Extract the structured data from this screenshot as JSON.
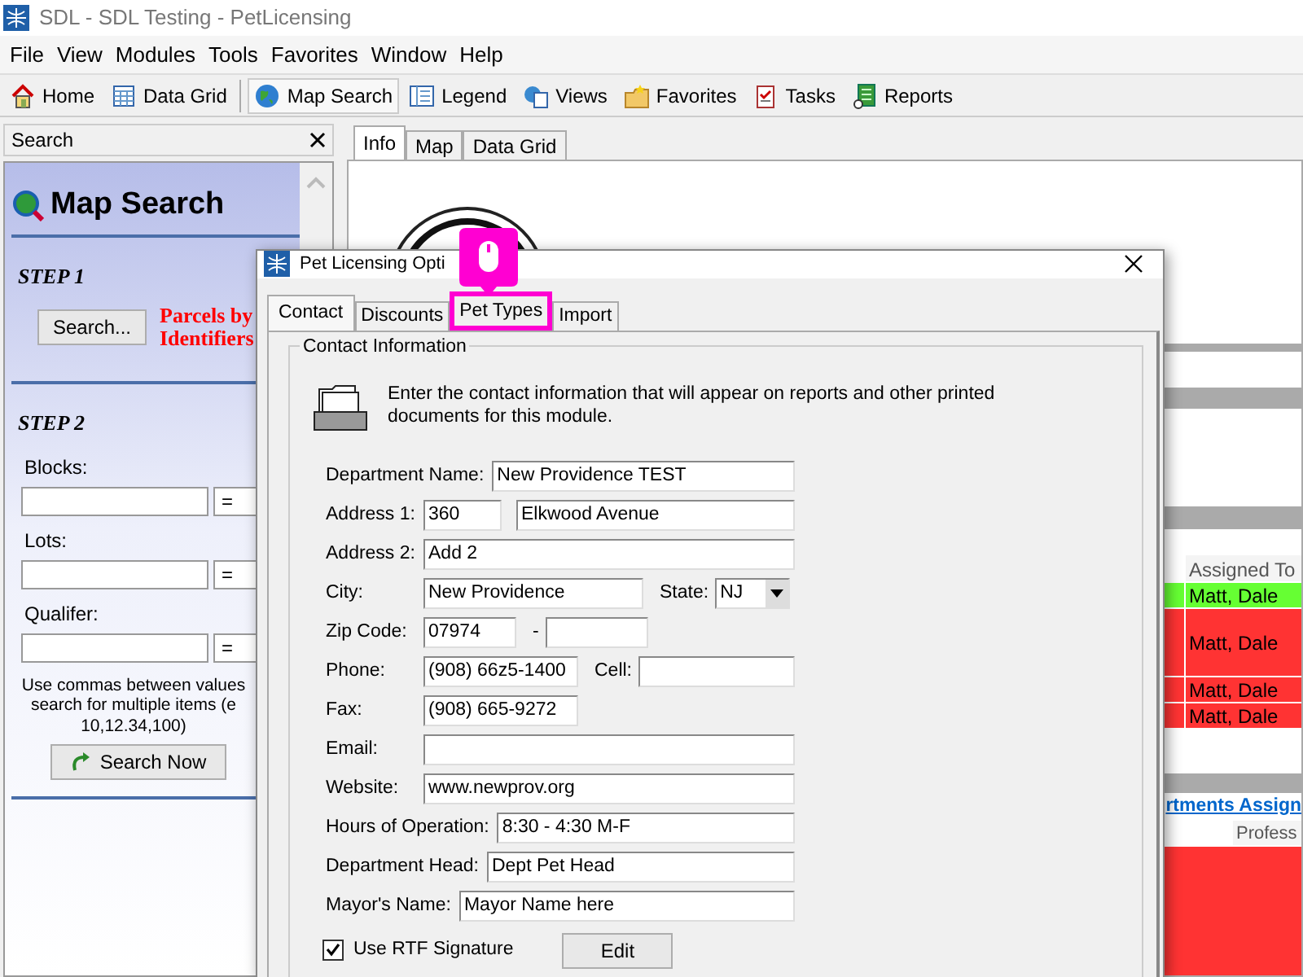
{
  "window": {
    "title": "SDL - SDL Testing - PetLicensing"
  },
  "menu": [
    "File",
    "View",
    "Modules",
    "Tools",
    "Favorites",
    "Window",
    "Help"
  ],
  "toolbar": [
    {
      "label": "Home",
      "kind": "home",
      "selected": false
    },
    {
      "label": "Data Grid",
      "kind": "grid",
      "selected": false
    },
    {
      "label": "Map Search",
      "kind": "globe",
      "selected": true
    },
    {
      "label": "Legend",
      "kind": "legend",
      "selected": false
    },
    {
      "label": "Views",
      "kind": "views",
      "selected": false
    },
    {
      "label": "Favorites",
      "kind": "folder",
      "selected": false
    },
    {
      "label": "Tasks",
      "kind": "tasks",
      "selected": false
    },
    {
      "label": "Reports",
      "kind": "reports",
      "selected": false
    }
  ],
  "search_panel": {
    "title": "Search",
    "heading": "Map Search",
    "step1": "STEP 1",
    "search_button": "Search...",
    "search_type": "Parcels by Identifiers",
    "step2": "STEP 2",
    "fields": [
      {
        "label": "Blocks:",
        "operator": "="
      },
      {
        "label": "Lots:",
        "operator": "="
      },
      {
        "label": "Qualifer:",
        "operator": "="
      }
    ],
    "hint": [
      "Use commas between values",
      "search for multiple items (e",
      "10,12.34,100)"
    ],
    "search_now": "Search Now"
  },
  "main_tabs": [
    {
      "label": "Info",
      "selected": true
    },
    {
      "label": "Map",
      "selected": false
    },
    {
      "label": "Data Grid",
      "selected": false
    }
  ],
  "assignments": {
    "column": "Assigned To",
    "rows": [
      {
        "value": "Matt, Dale",
        "color": "#66ff33"
      },
      {
        "value": "Matt, Dale",
        "color": "#ff3333"
      },
      {
        "value": "Matt, Dale",
        "color": "#ff3333"
      },
      {
        "value": "Matt, Dale",
        "color": "#ff3333"
      }
    ]
  },
  "departments": {
    "link": "rtments Assign",
    "column": "Profess"
  },
  "dialog": {
    "title": "Pet Licensing Opti",
    "tabs": [
      {
        "label": "Contact",
        "selected": true,
        "highlighted": false
      },
      {
        "label": "Discounts",
        "selected": false,
        "highlighted": false
      },
      {
        "label": "Pet Types",
        "selected": false,
        "highlighted": true
      },
      {
        "label": "Import",
        "selected": false,
        "highlighted": false
      }
    ],
    "group": "Contact Information",
    "intro": "Enter the contact information that will appear on reports and other printed documents for this module.",
    "rows": [
      {
        "fields": [
          {
            "label": "Department Name:",
            "value": "New Providence TEST"
          }
        ]
      },
      {
        "fields": [
          {
            "label": "Address 1:",
            "value": "360"
          },
          {
            "value": "Elkwood Avenue"
          }
        ]
      },
      {
        "fields": [
          {
            "label": "Address 2:",
            "value": "Add 2"
          }
        ]
      },
      {
        "fields": [
          {
            "label": "City:",
            "value": "New Providence"
          },
          {
            "label": "State:",
            "value": "NJ",
            "kind": "select"
          }
        ]
      },
      {
        "fields": [
          {
            "label": "Zip Code:",
            "value": "07974"
          },
          {
            "label": "-"
          }
        ]
      },
      {
        "fields": [
          {
            "label": "Phone:",
            "value": "(908) 66z5-1400"
          },
          {
            "label": "Cell:"
          }
        ]
      },
      {
        "fields": [
          {
            "label": "Fax:",
            "value": "(908) 665-9272"
          }
        ]
      },
      {
        "fields": [
          {
            "label": "Email:"
          }
        ]
      },
      {
        "fields": [
          {
            "label": "Website:",
            "value": "www.newprov.org"
          }
        ]
      },
      {
        "fields": [
          {
            "label": "Hours of Operation:",
            "value": "8:30 - 4:30 M-F"
          }
        ]
      },
      {
        "fields": [
          {
            "label": "Department Head:",
            "value": "Dept Pet Head"
          }
        ]
      },
      {
        "fields": [
          {
            "label": "Mayor's Name:",
            "value": "Mayor Name here"
          }
        ]
      }
    ],
    "rtf": {
      "label": "Use RTF Signature",
      "checked": true
    },
    "edit_button": "Edit"
  }
}
